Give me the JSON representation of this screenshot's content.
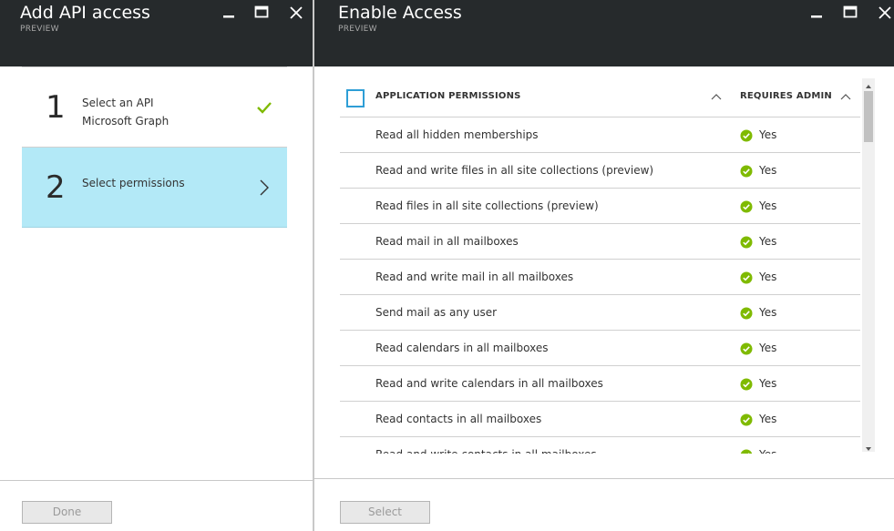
{
  "left_blade": {
    "title": "Add API access",
    "subtitle": "PREVIEW",
    "steps": [
      {
        "number": "1",
        "label": "Select an API",
        "value": "Microsoft Graph",
        "status_icon": "check-icon"
      },
      {
        "number": "2",
        "label": "Select permissions",
        "status_icon": "chevron-right-icon"
      }
    ],
    "done_label": "Done"
  },
  "right_blade": {
    "title": "Enable Access",
    "subtitle": "PREVIEW",
    "columns": {
      "permission": "APPLICATION PERMISSIONS",
      "admin": "REQUIRES ADMIN"
    },
    "rows": [
      {
        "permission": "Read all hidden memberships",
        "admin": "Yes"
      },
      {
        "permission": "Read and write files in all site collections (preview)",
        "admin": "Yes"
      },
      {
        "permission": "Read files in all site collections (preview)",
        "admin": "Yes"
      },
      {
        "permission": "Read mail in all mailboxes",
        "admin": "Yes"
      },
      {
        "permission": "Read and write mail in all mailboxes",
        "admin": "Yes"
      },
      {
        "permission": "Send mail as any user",
        "admin": "Yes"
      },
      {
        "permission": "Read calendars in all mailboxes",
        "admin": "Yes"
      },
      {
        "permission": "Read and write calendars in all mailboxes",
        "admin": "Yes"
      },
      {
        "permission": "Read contacts in all mailboxes",
        "admin": "Yes"
      },
      {
        "permission": "Read and write contacts in all mailboxes",
        "admin": "Yes"
      }
    ],
    "select_label": "Select"
  },
  "colors": {
    "header_bg": "#262a2c",
    "selected_step_bg": "#b3e9f7",
    "check_green": "#7fba00",
    "checkbox_border": "#2e9ed6"
  }
}
